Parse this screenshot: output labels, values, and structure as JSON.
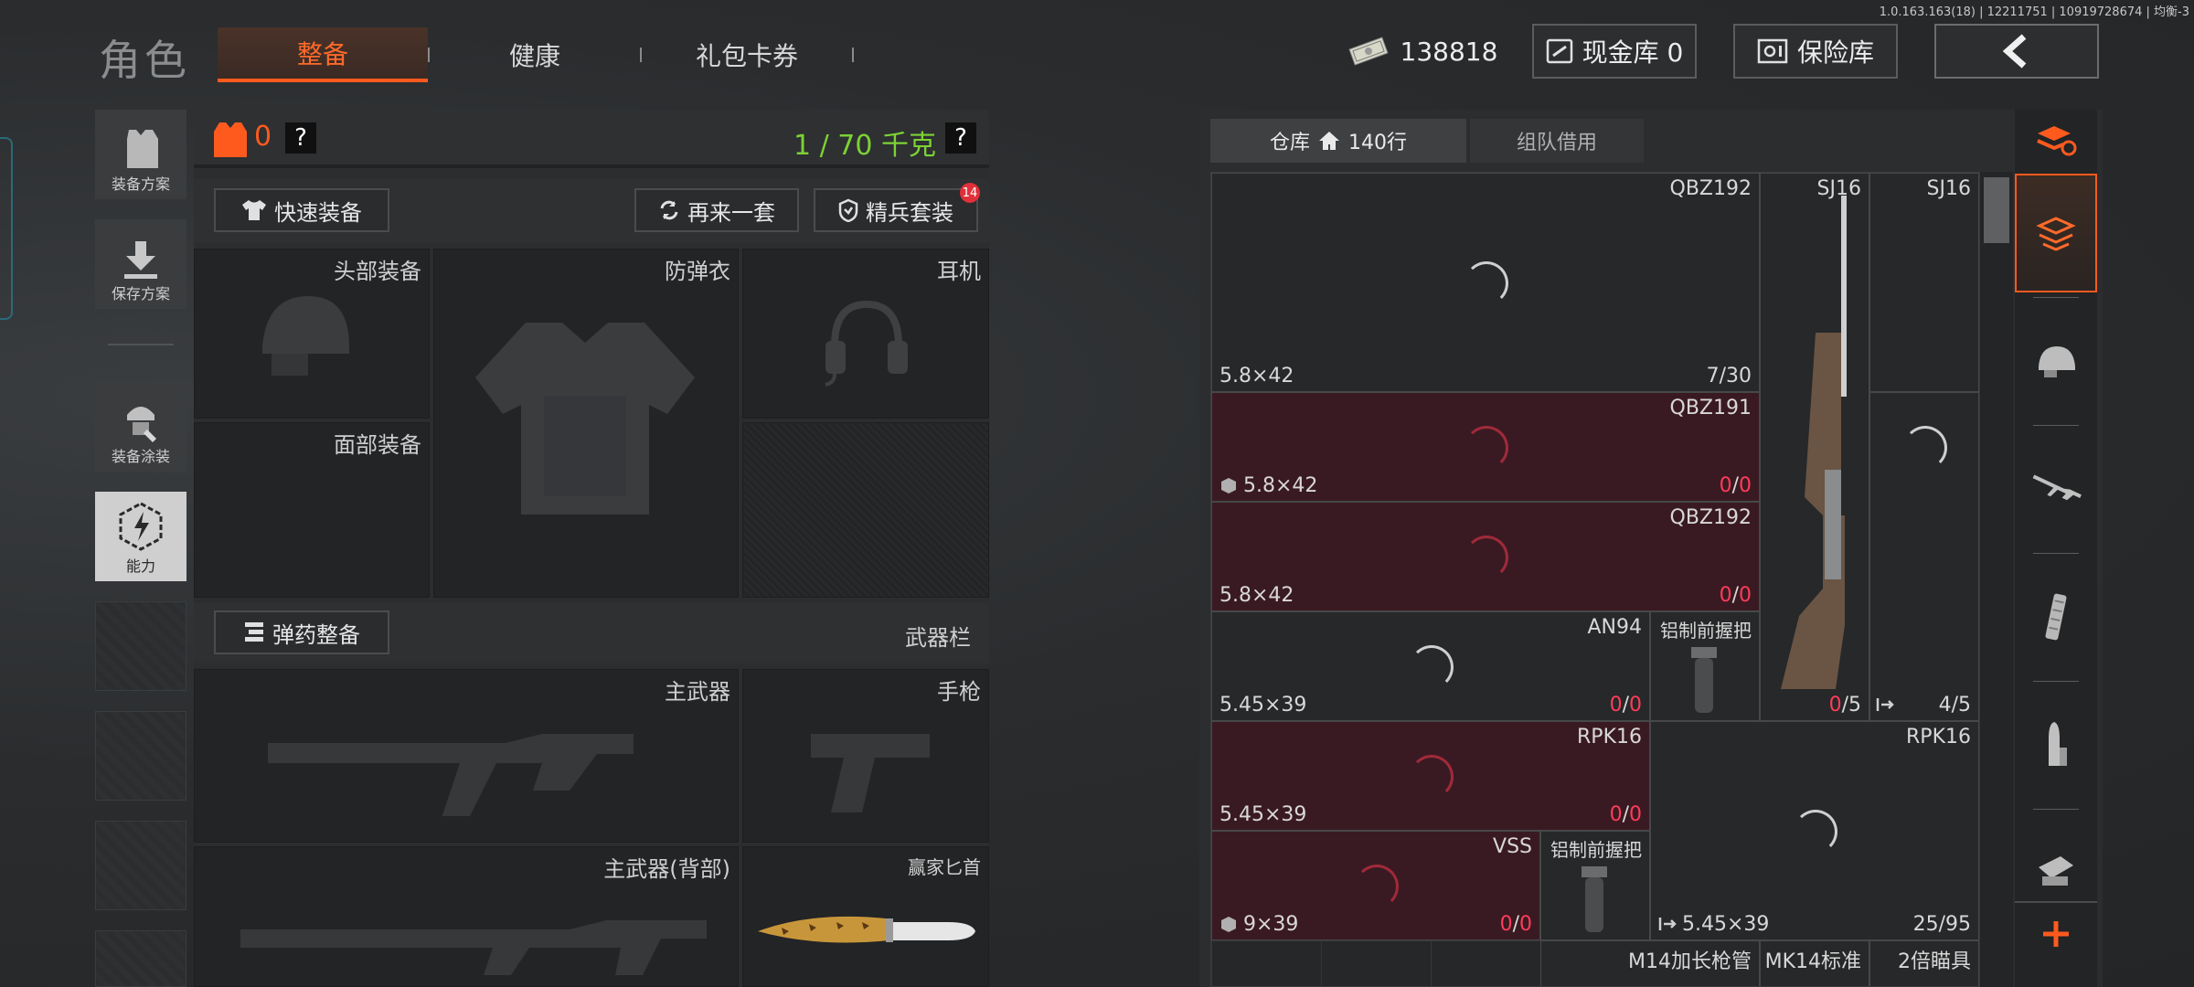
{
  "version": "1.0.163.163(18) | 12211751 | 10919728674 | 均衡-3",
  "header": {
    "title": "角色",
    "tabs": [
      "整备",
      "健康",
      "礼包卡券"
    ],
    "currency": "138818",
    "cash_vault": "现金库 0",
    "safe_vault": "保险库"
  },
  "left_menu": [
    "装备方案",
    "保存方案",
    "装备涂装",
    "能力"
  ],
  "equipment": {
    "armor_value": "0",
    "help_glyph": "?",
    "weight": "1 / 70 千克",
    "quick_equip": "快速装备",
    "reequip": "再来一套",
    "elite_set": "精兵套装",
    "elite_badge": "14",
    "ammo_manage": "弹药整备",
    "weapon_bar": "武器栏",
    "slots": {
      "head": "头部装备",
      "armor": "防弹衣",
      "headset": "耳机",
      "face": "面部装备",
      "primary": "主武器",
      "pistol": "手枪",
      "primary_back": "主武器(背部)",
      "melee": "赢家匕首"
    }
  },
  "inventory": {
    "tab_warehouse": "仓库",
    "rows": "140行",
    "tab_team": "组队借用",
    "slash": "/",
    "items": [
      {
        "name": "QBZ192",
        "caliber": "5.8×42",
        "count": "7/30"
      },
      {
        "name": "QBZ191",
        "caliber": "5.8×42",
        "count_a": "0",
        "count_b": "0"
      },
      {
        "name": "QBZ192",
        "caliber": "5.8×42",
        "count_a": "0",
        "count_b": "0"
      },
      {
        "name": "AN94",
        "caliber": "5.45×39",
        "count_a": "0",
        "count_b": "0"
      },
      {
        "name": "铝制前握把"
      },
      {
        "name": "SJ16",
        "count_a": "0",
        "count_b": "/5"
      },
      {
        "name": "SJ16"
      },
      {
        "count": "4/5"
      },
      {
        "name": "RPK16",
        "caliber": "5.45×39",
        "count_a": "0",
        "count_b": "0"
      },
      {
        "name": "VSS",
        "caliber": "9×39",
        "count_a": "0",
        "count_b": "0"
      },
      {
        "name": "铝制前握把"
      },
      {
        "name": "RPK16",
        "caliber": "5.45×39",
        "count": "25/95"
      },
      {
        "name": "M14加长枪管"
      },
      {
        "name": "MK14标准"
      },
      {
        "name": "2倍瞄具"
      }
    ]
  },
  "colors": {
    "accent": "#ff5a1e",
    "weight_ok": "#7cd234",
    "empty_count": "#ff3c5a",
    "item_unusable_bg": "#3a1a22"
  }
}
